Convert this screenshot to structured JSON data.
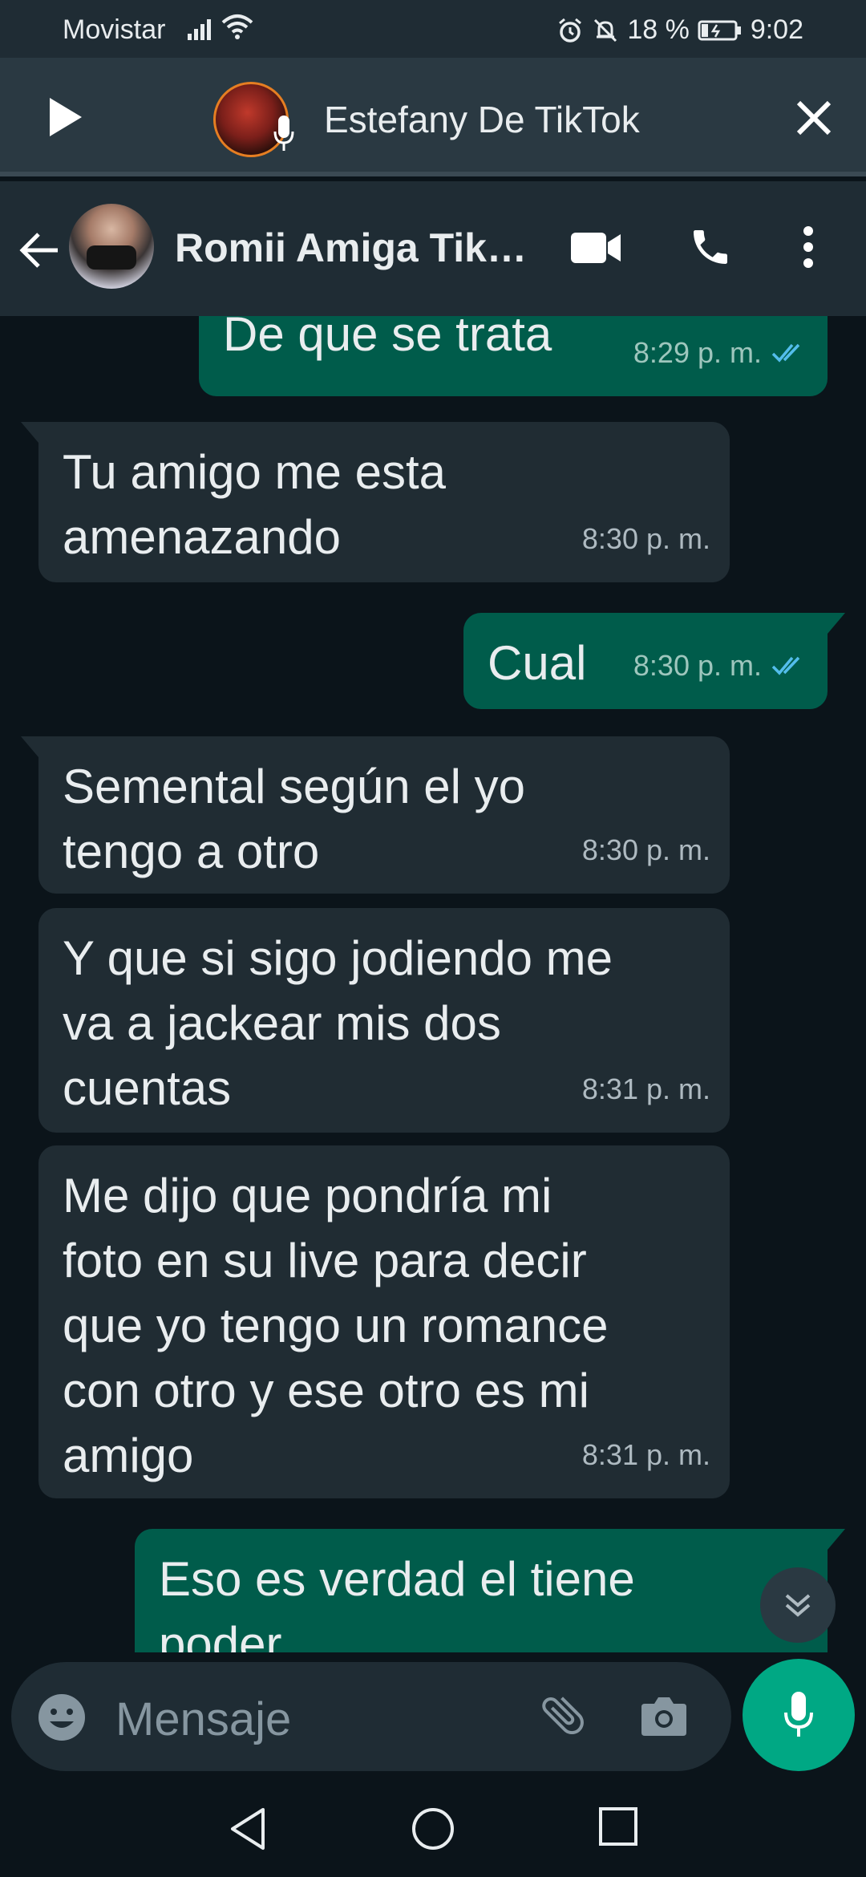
{
  "status_bar": {
    "carrier": "Movistar",
    "battery": "18 %",
    "time": "9:02"
  },
  "voice_player": {
    "title": "Estefany De TikTok"
  },
  "chat_header": {
    "contact_name": "Romii Amiga Tik…"
  },
  "messages": [
    {
      "direction": "out",
      "text": "De que se trata",
      "time": "8:29 p. m.",
      "read": true
    },
    {
      "direction": "in",
      "text": "Tu amigo me esta\namenazando",
      "time": "8:30 p. m."
    },
    {
      "direction": "out",
      "text": "Cual",
      "time": "8:30 p. m.",
      "read": true
    },
    {
      "direction": "in",
      "text": "Semental según el yo\ntengo a otro",
      "time": "8:30 p. m."
    },
    {
      "direction": "in",
      "text": "Y que si sigo jodiendo me\nva a jackear mis dos\ncuentas",
      "time": "8:31 p. m."
    },
    {
      "direction": "in",
      "text": "Me dijo que pondría mi\nfoto en su live para decir\nque yo tengo un romance\ncon otro y ese otro es mi\namigo",
      "time": "8:31 p. m."
    },
    {
      "direction": "out",
      "text": "Eso es verdad el tiene\npoder",
      "time": ""
    }
  ],
  "input": {
    "placeholder": "Mensaje"
  },
  "colors": {
    "background": "#0b141a",
    "incoming_bubble": "#202c33",
    "outgoing_bubble": "#005c4b",
    "accent": "#00a884",
    "read_ticks": "#53bdeb"
  },
  "icons": {
    "status": [
      "signal-icon",
      "wifi-icon",
      "alarm-icon",
      "mute-icon",
      "battery-icon"
    ],
    "voice_player": [
      "play-icon",
      "mic-icon",
      "close-icon"
    ],
    "header": [
      "back-arrow-icon",
      "video-call-icon",
      "phone-icon",
      "more-vert-icon"
    ],
    "input": [
      "emoji-icon",
      "attach-icon",
      "camera-icon",
      "mic-icon"
    ],
    "nav": [
      "back-triangle-icon",
      "home-circle-icon",
      "recents-square-icon"
    ]
  }
}
